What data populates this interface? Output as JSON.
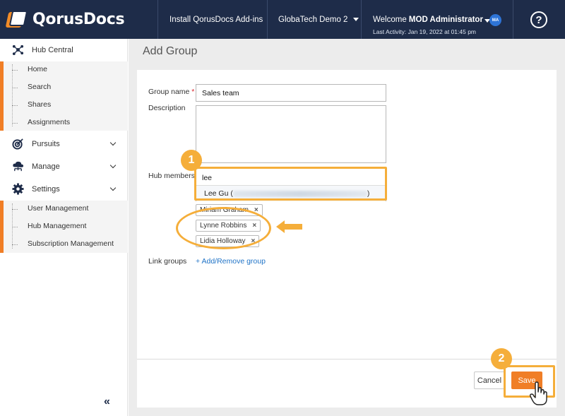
{
  "header": {
    "logo_text": "QorusDocs",
    "install_label": "Install QorusDocs Add-ins",
    "workspace": "GlobaTech Demo 2",
    "welcome_prefix": "Welcome",
    "user_name": "MOD Administrator",
    "last_activity": "Last Activity: Jan 19, 2022 at 01:45 pm",
    "avatar_initials": "MA",
    "help_glyph": "?"
  },
  "sidebar": {
    "hub_central": "Hub Central",
    "hub_items": [
      "Home",
      "Search",
      "Shares",
      "Assignments"
    ],
    "pursuits": "Pursuits",
    "manage": "Manage",
    "settings": "Settings",
    "settings_items": [
      "User Management",
      "Hub Management",
      "Subscription Management"
    ],
    "collapse_glyph": "«"
  },
  "page": {
    "title": "Add Group"
  },
  "form": {
    "group_name_label": "Group name",
    "required_mark": "*",
    "group_name_value": "Sales team",
    "description_label": "Description",
    "description_value": "",
    "hub_members_label": "Hub members",
    "member_search_value": "lee",
    "suggestion_name": "Lee Gu (",
    "suggestion_suffix": ")",
    "members": [
      "Miriam Graham",
      "Lynne Robbins",
      "Lidia Holloway"
    ],
    "remove_glyph": "×",
    "link_groups_label": "Link groups",
    "add_remove_group": "+ Add/Remove group",
    "cancel_label": "Cancel",
    "save_label": "Save"
  },
  "callouts": {
    "step1": "1",
    "step2": "2"
  },
  "colors": {
    "header_bg": "#1e2c49",
    "accent_orange": "#f07e26",
    "callout_yellow": "#f5ae3a",
    "link_blue": "#1f73c7"
  }
}
